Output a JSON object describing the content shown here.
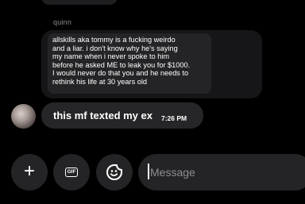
{
  "quoted_message": {
    "sender": "quinn",
    "lines": [
      "allskills aka tommy is a fucking weirdo",
      "and a liar. i don't know why he's saying",
      "my name when i never spoke to him",
      "before he asked ME to leak you for $1000.",
      "I would never do that you and he needs to",
      "rethink his life at 30 years old"
    ]
  },
  "message": {
    "text": "this mf texted my ex",
    "time": "7:26 PM"
  },
  "composer": {
    "placeholder": "Message",
    "value": "",
    "gif_label": "GIF",
    "plus_label": "+",
    "plus_icon": "plus-icon",
    "gif_icon": "gif-icon",
    "emoji_icon": "sticker-smile-icon"
  },
  "colors": {
    "background": "#000000",
    "bubble": "#262628",
    "text": "#ffffff",
    "muted": "#8e8e93"
  }
}
